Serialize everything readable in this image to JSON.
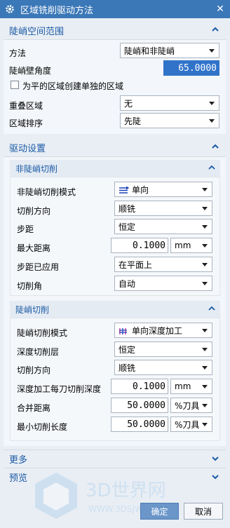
{
  "window": {
    "title": "区域铣削驱动方法"
  },
  "steep_region": {
    "header": "陡峭空间范围",
    "method_label": "方法",
    "method_value": "陡峭和非陡峭",
    "wall_angle_label": "陡峭壁角度",
    "wall_angle_value": "65.0000",
    "flat_checkbox_label": "为平的区域创建单独的区域",
    "overlap_label": "重叠区域",
    "overlap_value": "无",
    "order_label": "区域排序",
    "order_value": "先陡"
  },
  "drive": {
    "header": "驱动设置",
    "nonsteep": {
      "header": "非陡峭切削",
      "pattern_label": "非陡峭切削模式",
      "pattern_value": "单向",
      "direction_label": "切削方向",
      "direction_value": "顺铣",
      "stepover_label": "步距",
      "stepover_value": "恒定",
      "max_dist_label": "最大距离",
      "max_dist_value": "0.1000",
      "max_dist_unit": "mm",
      "applied_label": "步距已应用",
      "applied_value": "在平面上",
      "angle_label": "切削角",
      "angle_value": "自动"
    },
    "steep": {
      "header": "陡峭切削",
      "pattern_label": "陡峭切削模式",
      "pattern_value": "单向深度加工",
      "depth_layer_label": "深度切削层",
      "depth_layer_value": "恒定",
      "direction_label": "切削方向",
      "direction_value": "顺铣",
      "depth_per_cut_label": "深度加工每刀切削深度",
      "depth_per_cut_value": "0.1000",
      "depth_per_cut_unit": "mm",
      "merge_label": "合并距离",
      "merge_value": "50.0000",
      "merge_unit": "%刀具",
      "min_len_label": "最小切削长度",
      "min_len_value": "50.0000",
      "min_len_unit": "%刀具"
    }
  },
  "more": {
    "header": "更多"
  },
  "preview": {
    "header": "预览"
  },
  "buttons": {
    "ok": "确定",
    "cancel": "取消"
  },
  "watermark": {
    "text": "3D世界网",
    "url": "WWW.3DSJW.COM"
  },
  "colors": {
    "titlebar": "#3b78b8",
    "header_text": "#1b5aa6",
    "selection": "#3173c9"
  }
}
